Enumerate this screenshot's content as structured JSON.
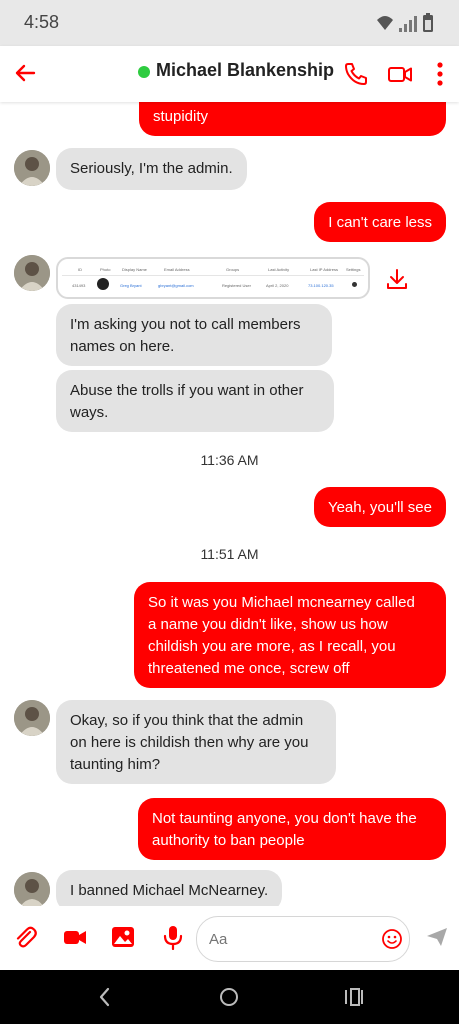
{
  "status_bar": {
    "time": "4:58"
  },
  "header": {
    "contact_name": "Michael Blankenship",
    "presence_color": "#2ecc40",
    "accent_color": "#ff0000"
  },
  "messages": [
    {
      "dir": "out",
      "text": "stupidity"
    },
    {
      "dir": "in",
      "text": "Seriously, I'm the admin."
    },
    {
      "dir": "out",
      "text": "I can't care less"
    },
    {
      "dir": "in",
      "type": "image",
      "caption": "screenshot-attachment"
    },
    {
      "dir": "in",
      "text": "I'm asking you not to call members",
      "text2": "names on here."
    },
    {
      "dir": "in",
      "text": "Abuse the trolls if you want in other",
      "text2": "ways."
    },
    {
      "dir": "out",
      "text": "Yeah, you'll see"
    },
    {
      "dir": "out",
      "lines": [
        "So it was you Michael mcnearney called",
        "a name you didn't like, show us how",
        "childish you are more, as I recall, you",
        "threatened me once, screw off"
      ]
    },
    {
      "dir": "in",
      "lines": [
        "Okay, so if you think that the admin",
        "on here is childish then why are you",
        "taunting him?"
      ]
    },
    {
      "dir": "out",
      "lines": [
        "Not taunting anyone, you don't have the",
        "authority to ban people"
      ]
    },
    {
      "dir": "in",
      "text": "I banned Michael McNearney."
    }
  ],
  "timestamps": [
    "11:36 AM",
    "11:51 AM"
  ],
  "screenshot_table": {
    "headers": [
      "ID",
      "Photo",
      "Display Name",
      "Email Address",
      "Groups",
      "Last Activity",
      "Last IP Address",
      "Settings"
    ],
    "row": [
      "431493",
      "",
      "Greg Bryant",
      "gbryant@gmail.com",
      "Registered User",
      "April 2, 2020",
      "73.100.120.35",
      ""
    ]
  },
  "composer": {
    "placeholder": "Aa"
  }
}
